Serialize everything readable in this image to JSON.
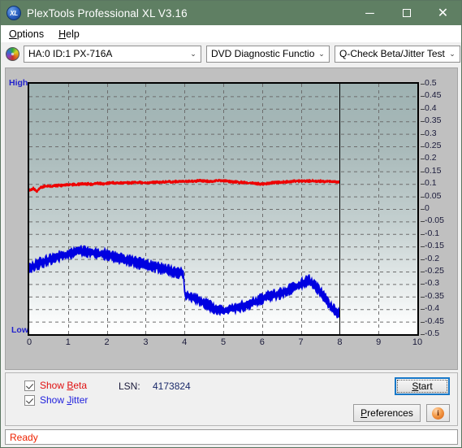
{
  "window": {
    "title": "PlexTools Professional XL V3.16",
    "app_icon": "XL",
    "minimize": "─",
    "maximize": "",
    "close": "✕"
  },
  "menubar": {
    "items": [
      {
        "label": "Options",
        "accel": "O"
      },
      {
        "label": "Help",
        "accel": "H"
      }
    ]
  },
  "toolbar": {
    "drive_icon": "disc-icon",
    "drive": {
      "value": "HA:0 ID:1  PX-716A",
      "arrow": "⌄"
    },
    "function": {
      "value": "DVD Diagnostic Functions",
      "arrow": "⌄"
    },
    "test": {
      "value": "Q-Check Beta/Jitter Test",
      "arrow": "⌄"
    }
  },
  "chart_data": {
    "type": "line",
    "title": "",
    "xlabel": "",
    "ylabel": "",
    "xlim": [
      0,
      10
    ],
    "ylim": [
      -0.5,
      0.5
    ],
    "grid": true,
    "legend_position": "below-plot",
    "left_axis_top_label": "High",
    "left_axis_bottom_label": "Low",
    "xticks": [
      0,
      1,
      2,
      3,
      4,
      5,
      6,
      7,
      8,
      9,
      10
    ],
    "yticks": [
      0.5,
      0.45,
      0.4,
      0.35,
      0.3,
      0.25,
      0.2,
      0.15,
      0.1,
      0.05,
      0,
      -0.05,
      -0.1,
      -0.15,
      -0.2,
      -0.25,
      -0.3,
      -0.35,
      -0.4,
      -0.45,
      -0.5
    ],
    "ytick_labels": [
      "0.5",
      "0.45",
      "0.4",
      "0.35",
      "0.3",
      "0.25",
      "0.2",
      "0.15",
      "0.1",
      "0.05",
      "0",
      "-0.05",
      "-0.1",
      "-0.15",
      "-0.2",
      "-0.25",
      "-0.3",
      "-0.35",
      "-0.4",
      "-0.45",
      "-0.5"
    ],
    "data_end_x": 8.0,
    "marker_line_x": 8.0,
    "series": [
      {
        "name": "Beta",
        "color": "#ee0000",
        "x": [
          0.0,
          0.1,
          0.2,
          0.3,
          0.4,
          0.5,
          0.6,
          0.7,
          0.8,
          0.9,
          1.0,
          1.1,
          1.2,
          1.3,
          1.4,
          1.5,
          1.6,
          1.7,
          1.8,
          1.9,
          2.0,
          2.1,
          2.2,
          2.3,
          2.4,
          2.5,
          2.6,
          2.7,
          2.8,
          2.9,
          3.0,
          3.1,
          3.2,
          3.3,
          3.4,
          3.5,
          3.6,
          3.7,
          3.8,
          3.9,
          4.0,
          4.1,
          4.2,
          4.3,
          4.4,
          4.5,
          4.6,
          4.7,
          4.8,
          4.9,
          5.0,
          5.1,
          5.2,
          5.3,
          5.4,
          5.5,
          5.6,
          5.7,
          5.8,
          5.9,
          6.0,
          6.1,
          6.2,
          6.3,
          6.4,
          6.5,
          6.6,
          6.7,
          6.8,
          6.9,
          7.0,
          7.1,
          7.2,
          7.3,
          7.4,
          7.5,
          7.6,
          7.7,
          7.8,
          7.9,
          8.0
        ],
        "y": [
          0.075,
          0.082,
          0.07,
          0.086,
          0.09,
          0.092,
          0.09,
          0.093,
          0.094,
          0.094,
          0.096,
          0.098,
          0.097,
          0.099,
          0.1,
          0.1,
          0.099,
          0.101,
          0.102,
          0.1,
          0.102,
          0.104,
          0.104,
          0.103,
          0.104,
          0.105,
          0.104,
          0.105,
          0.106,
          0.105,
          0.104,
          0.105,
          0.107,
          0.106,
          0.107,
          0.108,
          0.109,
          0.108,
          0.11,
          0.109,
          0.11,
          0.111,
          0.11,
          0.112,
          0.113,
          0.112,
          0.11,
          0.109,
          0.112,
          0.113,
          0.112,
          0.11,
          0.109,
          0.108,
          0.107,
          0.106,
          0.104,
          0.103,
          0.102,
          0.101,
          0.1,
          0.101,
          0.103,
          0.105,
          0.106,
          0.107,
          0.108,
          0.109,
          0.11,
          0.111,
          0.111,
          0.112,
          0.112,
          0.112,
          0.111,
          0.111,
          0.11,
          0.11,
          0.109,
          0.108,
          0.107
        ],
        "noise": 0.006
      },
      {
        "name": "Jitter",
        "color": "#0000e0",
        "x": [
          0.0,
          0.1,
          0.2,
          0.3,
          0.4,
          0.5,
          0.6,
          0.7,
          0.8,
          0.9,
          1.0,
          1.1,
          1.2,
          1.3,
          1.4,
          1.5,
          1.6,
          1.7,
          1.8,
          1.9,
          2.0,
          2.1,
          2.2,
          2.3,
          2.4,
          2.5,
          2.6,
          2.7,
          2.8,
          2.9,
          3.0,
          3.1,
          3.2,
          3.3,
          3.4,
          3.5,
          3.6,
          3.7,
          3.8,
          3.9,
          3.99,
          4.0,
          4.1,
          4.2,
          4.3,
          4.4,
          4.5,
          4.6,
          4.7,
          4.8,
          4.9,
          5.0,
          5.1,
          5.2,
          5.3,
          5.4,
          5.5,
          5.6,
          5.7,
          5.8,
          5.9,
          6.0,
          6.1,
          6.2,
          6.3,
          6.4,
          6.5,
          6.6,
          6.7,
          6.8,
          6.9,
          7.0,
          7.1,
          7.2,
          7.3,
          7.4,
          7.5,
          7.6,
          7.7,
          7.8,
          7.9,
          8.0
        ],
        "y": [
          -0.235,
          -0.23,
          -0.222,
          -0.215,
          -0.208,
          -0.203,
          -0.198,
          -0.192,
          -0.188,
          -0.185,
          -0.18,
          -0.176,
          -0.172,
          -0.17,
          -0.168,
          -0.17,
          -0.172,
          -0.175,
          -0.178,
          -0.18,
          -0.182,
          -0.188,
          -0.192,
          -0.196,
          -0.2,
          -0.205,
          -0.208,
          -0.212,
          -0.215,
          -0.218,
          -0.222,
          -0.226,
          -0.23,
          -0.234,
          -0.238,
          -0.242,
          -0.246,
          -0.25,
          -0.252,
          -0.255,
          -0.258,
          -0.34,
          -0.345,
          -0.352,
          -0.36,
          -0.368,
          -0.376,
          -0.384,
          -0.392,
          -0.398,
          -0.402,
          -0.406,
          -0.404,
          -0.4,
          -0.396,
          -0.392,
          -0.388,
          -0.384,
          -0.378,
          -0.372,
          -0.366,
          -0.36,
          -0.354,
          -0.348,
          -0.344,
          -0.34,
          -0.336,
          -0.33,
          -0.324,
          -0.316,
          -0.308,
          -0.3,
          -0.292,
          -0.286,
          -0.296,
          -0.312,
          -0.33,
          -0.352,
          -0.374,
          -0.396,
          -0.412,
          -0.42
        ],
        "noise": 0.022
      }
    ]
  },
  "controls": {
    "show_beta": {
      "label_prefix": "Show ",
      "label_accel": "B",
      "label_suffix": "eta",
      "checked": true
    },
    "show_jitter": {
      "label_prefix": "Show ",
      "label_accel": "J",
      "label_suffix": "itter",
      "checked": true
    },
    "lsn_label": "LSN:",
    "lsn_value": "4173824",
    "start_button": {
      "prefix": "",
      "accel": "S",
      "suffix": "tart"
    },
    "preferences_button": {
      "prefix": "",
      "accel": "P",
      "suffix": "references"
    },
    "info_button": {
      "glyph": "i"
    }
  },
  "statusbar": {
    "text": "Ready"
  }
}
